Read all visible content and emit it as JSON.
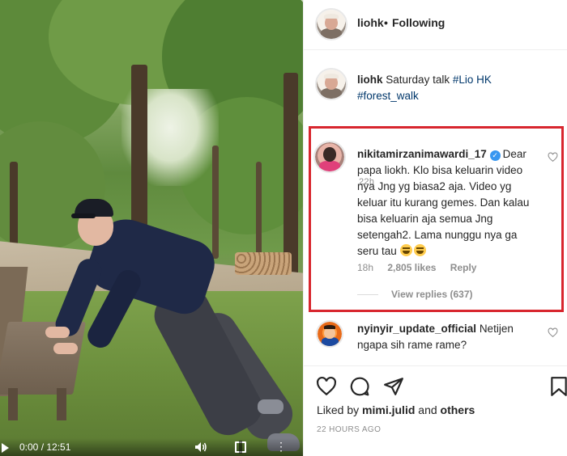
{
  "video": {
    "current_time": "0:00",
    "separator": " / ",
    "duration": "12:51"
  },
  "header": {
    "username": "liohk",
    "separator": "•",
    "follow_status": "Following"
  },
  "caption": {
    "username": "liohk",
    "text": "Saturday talk",
    "hashtags": [
      "#Lio HK",
      "#forest_walk"
    ],
    "time": "22h"
  },
  "comments": [
    {
      "username": "nikitamirzanimawardi_17",
      "verified": true,
      "text": "Dear papa liokh. Klo bisa keluarin video nya Jng yg biasa2 aja. Video yg keluar itu kurang gemes. Dan kalau bisa keluarin aja semua Jng setengah2. Lama nunggu nya ga seru tau",
      "emojis": [
        "joy-emoji",
        "joy-emoji"
      ],
      "time": "18h",
      "likes": "2,805 likes",
      "reply_label": "Reply",
      "view_replies": "View replies (637)"
    },
    {
      "username": "nyinyir_update_official",
      "verified": false,
      "text": "Netijen ngapa sih rame rame?"
    }
  ],
  "liked_by": {
    "prefix": "Liked by",
    "user": "mimi.julid",
    "conjunction": "and",
    "others": "others"
  },
  "post_time": "22 HOURS AGO",
  "colors": {
    "highlight_box": "#d8262e",
    "verified_badge": "#3897f0",
    "hashtag": "#00376b",
    "muted_text": "#8e8e8e"
  }
}
